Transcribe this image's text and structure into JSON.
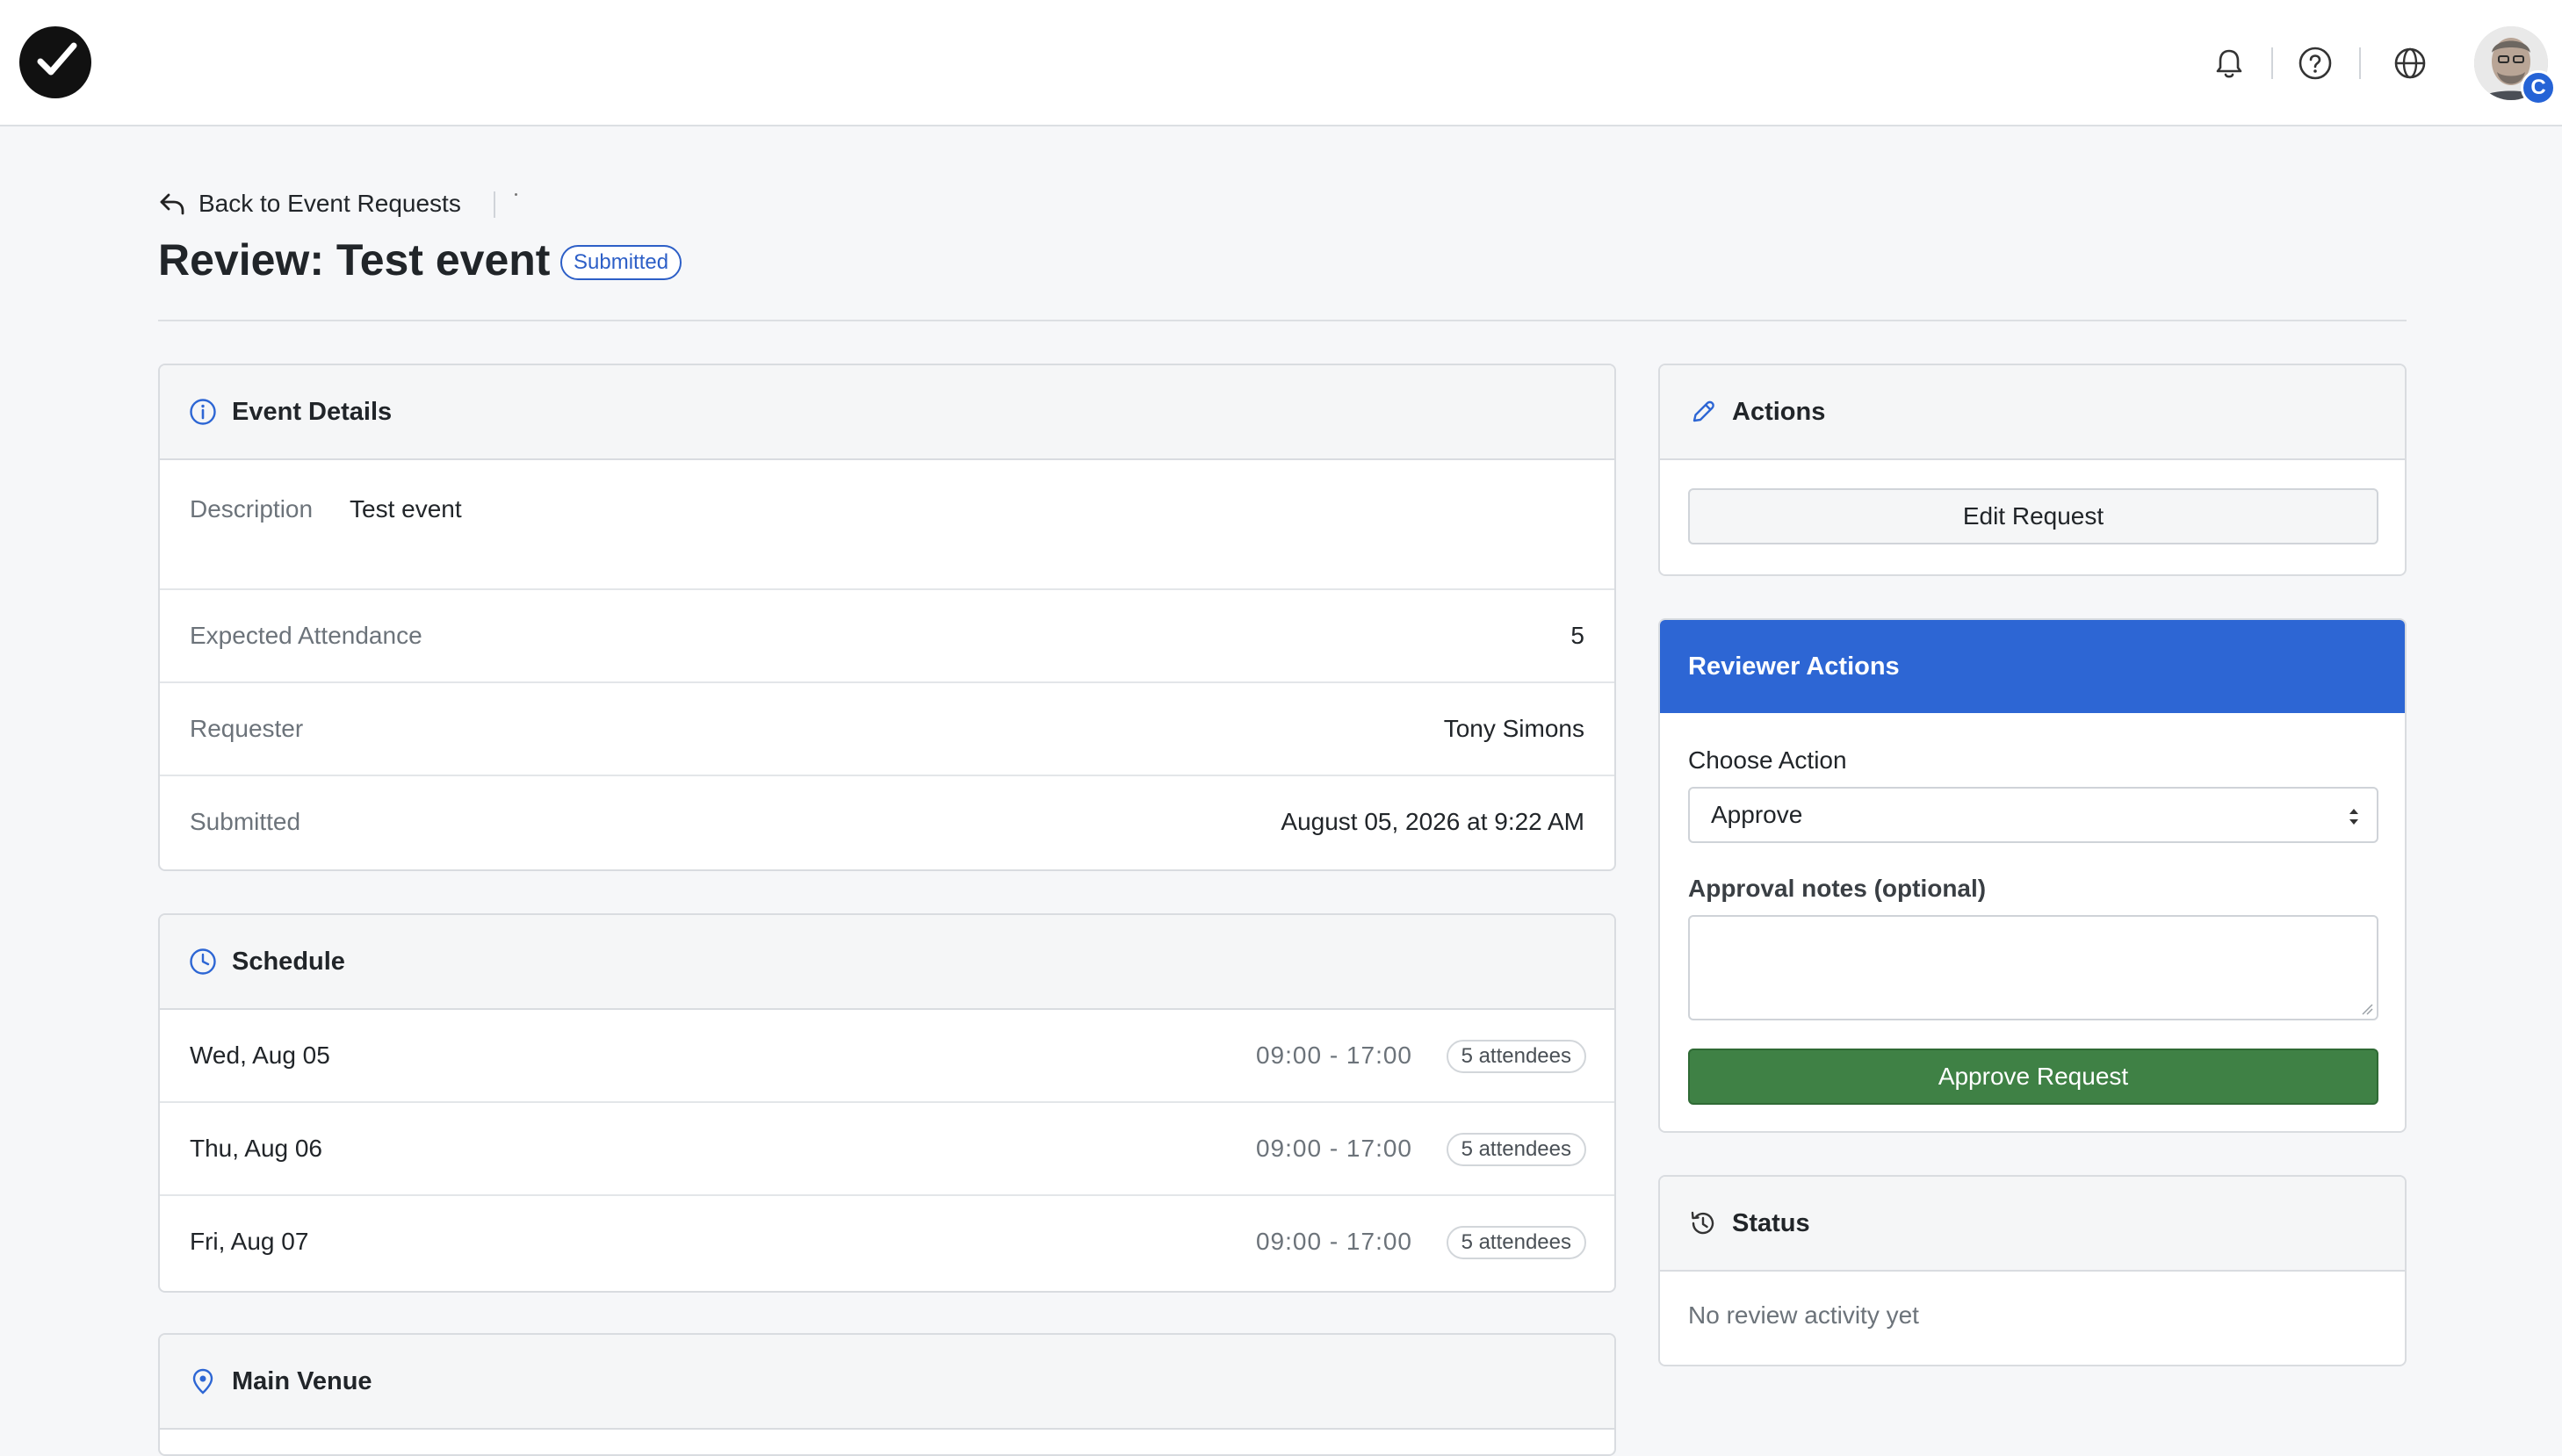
{
  "topbar": {
    "logo_icon": "checkmark-logo-icon",
    "icons": [
      "bell-icon",
      "help-circle-icon",
      "globe-icon"
    ],
    "avatar_badge": "C"
  },
  "header": {
    "back_label": "Back to Event Requests",
    "title": "Review: Test event",
    "status": "Submitted"
  },
  "event_details": {
    "title": "Event Details",
    "description_label": "Description",
    "description_value": "Test event",
    "attendance_label": "Expected Attendance",
    "attendance_value": "5",
    "requester_label": "Requester",
    "requester_value": "Tony Simons",
    "submitted_label": "Submitted",
    "submitted_value": "August 05, 2026 at 9:22 AM"
  },
  "schedule": {
    "title": "Schedule",
    "rows": [
      {
        "day": "Wed, Aug 05",
        "time": "09:00 - 17:00",
        "attendees": "5 attendees"
      },
      {
        "day": "Thu, Aug 06",
        "time": "09:00 - 17:00",
        "attendees": "5 attendees"
      },
      {
        "day": "Fri, Aug 07",
        "time": "09:00 - 17:00",
        "attendees": "5 attendees"
      }
    ]
  },
  "venue": {
    "title": "Main Venue"
  },
  "actions": {
    "title": "Actions",
    "edit_label": "Edit Request"
  },
  "reviewer": {
    "title": "Reviewer Actions",
    "choose_label": "Choose Action",
    "selected_action": "Approve",
    "notes_label": "Approval notes (optional)",
    "notes_value": "",
    "approve_label": "Approve Request"
  },
  "status_card": {
    "title": "Status",
    "empty_text": "No review activity yet"
  },
  "colors": {
    "accent": "#2d66d4",
    "approve": "#3f8145",
    "status_pill": "#2d5fc7"
  }
}
